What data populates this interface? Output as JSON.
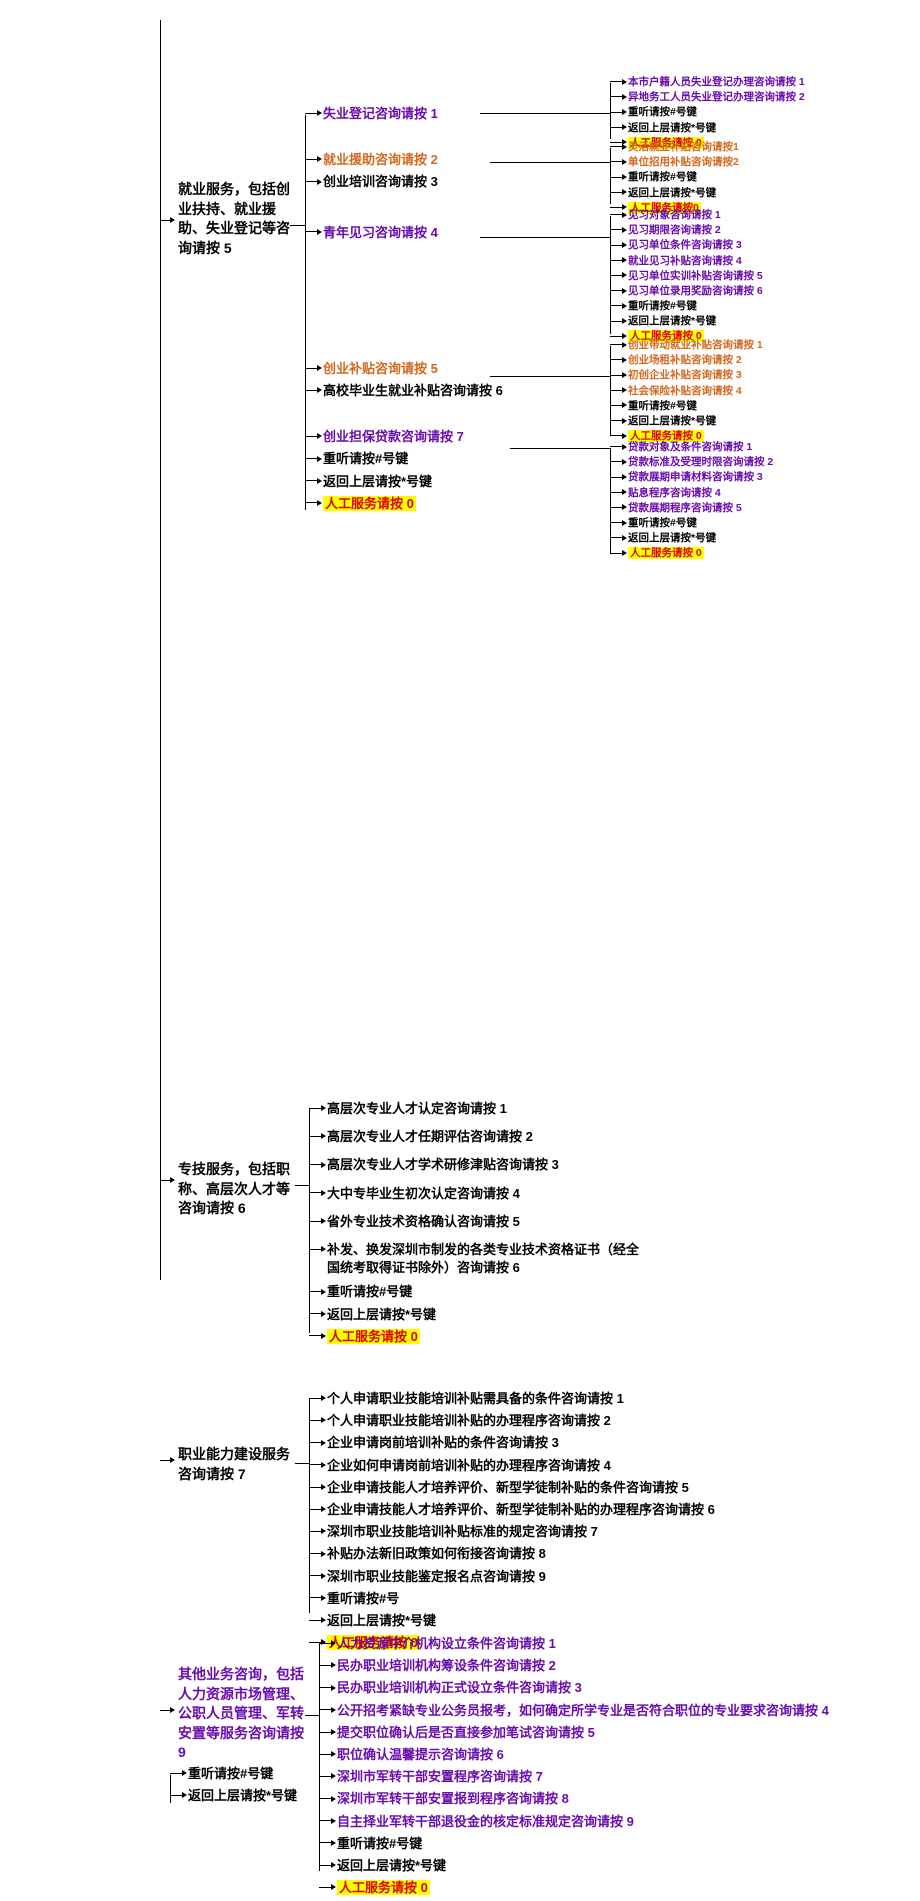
{
  "l1": {
    "employment": "就业服务，包括创业扶持、就业援助、失业登记等咨询请按 5",
    "professional": "专技服务，包括职称、高层次人才等咨询请按 6",
    "vocational": "职业能力建设服务咨询请按 7",
    "other": "其他业务咨询，包括人力资源市场管理、公职人员管理、军转安置等服务咨询请按 9",
    "replay": "重听请按#号键",
    "back": "返回上层请按*号键"
  },
  "employment_l2": {
    "i1": "失业登记咨询请按 1",
    "i2": "就业援助咨询请按 2",
    "i3": "创业培训咨询请按 3",
    "i4": "青年见习咨询请按 4",
    "i5": "创业补贴咨询请按 5",
    "i6": "高校毕业生就业补贴咨询请按 6",
    "i7": "创业担保贷款咨询请按 7",
    "replay": "重听请按#号键",
    "back": "返回上层请按*号键",
    "manual": "人工服务请按 0"
  },
  "unemp_reg_l3": {
    "a": "本市户籍人员失业登记办理咨询请按 1",
    "b": "异地务工人员失业登记办理咨询请按 2",
    "c": "重听请按#号键",
    "d": "返回上层请按*号键",
    "e": "人工服务请按 0"
  },
  "assist_l3": {
    "a": "灵活就业补贴咨询请按1",
    "b": "单位招用补贴咨询请按2",
    "c": "重听请按#号键",
    "d": "返回上层请按*号键",
    "e": "人工服务请按0"
  },
  "intern_l3": {
    "a": "见习对象咨询请按 1",
    "b": "见习期限咨询请按 2",
    "c": "见习单位条件咨询请按 3",
    "d": "就业见习补贴咨询请按 4",
    "e": "见习单位实训补贴咨询请按 5",
    "f": "见习单位录用奖励咨询请按 6",
    "g": "重听请按#号键",
    "h": "返回上层请按*号键",
    "i": "人工服务请按 0"
  },
  "startup_sub_l3": {
    "a": "创业带动就业补贴咨询请按 1",
    "b": "创业场租补贴咨询请按 2",
    "c": "初创企业补贴咨询请按 3",
    "d": "社会保险补贴咨询请按 4",
    "e": "重听请按#号键",
    "f": "返回上层请按*号键",
    "g": "人工服务请按 0"
  },
  "loan_l3": {
    "a": "贷款对象及条件咨询请按 1",
    "b": "贷款标准及受理时限咨询请按 2",
    "c": "贷款展期申请材料咨询请按 3",
    "d": "贴息程序咨询请按 4",
    "e": "贷款展期程序咨询请按 5",
    "f": "重听请按#号键",
    "g": "返回上层请按*号键",
    "h": "人工服务请按 0"
  },
  "professional_l2": {
    "a": "高层次专业人才认定咨询请按 1",
    "b": "高层次专业人才任期评估咨询请按 2",
    "c": "高层次专业人才学术研修津贴咨询请按 3",
    "d": "大中专毕业生初次认定咨询请按 4",
    "e": "省外专业技术资格确认咨询请按 5",
    "f": "补发、换发深圳市制发的各类专业技术资格证书（经全国统考取得证书除外）咨询请按 6",
    "g": "重听请按#号键",
    "h": "返回上层请按*号键",
    "i": "人工服务请按 0"
  },
  "vocational_l2": {
    "a": "个人申请职业技能培训补贴需具备的条件咨询请按 1",
    "b": "个人申请职业技能培训补贴的办理程序咨询请按 2",
    "c": "企业申请岗前培训补贴的条件咨询请按 3",
    "d": "企业如何申请岗前培训补贴的办理程序咨询请按 4",
    "e": "企业申请技能人才培养评价、新型学徒制补贴的条件咨询请按 5",
    "f": "企业申请技能人才培养评价、新型学徒制补贴的办理程序咨询请按 6",
    "g": "深圳市职业技能培训补贴标准的规定咨询请按 7",
    "h": "补贴办法新旧政策如何衔接咨询请按 8",
    "i": "深圳市职业技能鉴定报名点咨询请按 9",
    "j": "重听请按#号",
    "k": "返回上层请按*号键",
    "l": "人工服务请按 0"
  },
  "other_l2": {
    "a": "人力资源中介机构设立条件咨询请按 1",
    "b": "民办职业培训机构筹设条件咨询请按 2",
    "c": "民办职业培训机构正式设立条件咨询请按 3",
    "d": "公开招考紧缺专业公务员报考，如何确定所学专业是否符合职位的专业要求咨询请按 4",
    "e": "提交职位确认后是否直接参加笔试咨询请按 5",
    "f": "职位确认温馨提示咨询请按 6",
    "g": "深圳市军转干部安置程序咨询请按 7",
    "h": "深圳市军转干部安置报到程序咨询请按 8",
    "i": "自主择业军转干部退役金的核定标准规定咨询请按 9",
    "j": "重听请按#号键",
    "k": "返回上层请按*号键",
    "l": "人工服务请按 0"
  }
}
